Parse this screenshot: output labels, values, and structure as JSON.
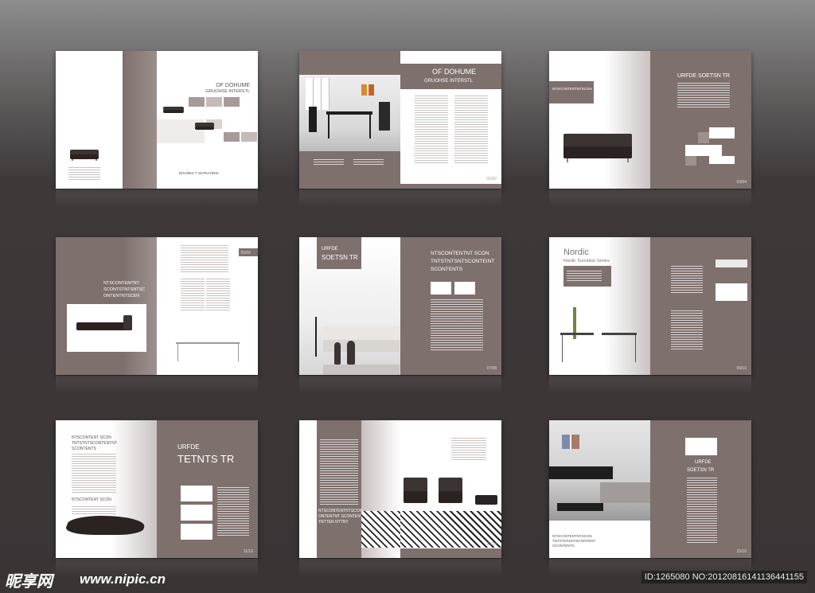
{
  "spread1": {
    "title_line1": "OF DOHUME",
    "title_line2": "GRUOHSE INTERSTL",
    "footer_text": "BOUNES T WARUVBGK"
  },
  "spread2": {
    "title_line1": "OF DOHUME",
    "title_line2": "GRUOHSE INTERSTL",
    "page": "01/02"
  },
  "spread3": {
    "heading": "URFDE   SOETSN   TR",
    "banner": "NTSCONTENTNTSCON",
    "page": "03/04"
  },
  "spread4": {
    "heading_l1": "NTSCONTENTNT",
    "heading_l2": "SCONTSTNTSNTSC",
    "heading_l3": "ONTENTNTSCEN",
    "page": "05/06"
  },
  "spread5": {
    "tab_l1": "URFDE",
    "tab_l2": "SOETSN   TR",
    "heading_l1": "NTSCONTENTNT   SCON",
    "heading_l2": "TNTSTNTSNTSCONTEINT",
    "heading_l3": "SCONTENTS",
    "page": "07/08"
  },
  "spread6": {
    "brand": "Nordic",
    "subtitle": "Nordic Sunshine Series",
    "page": "09/10"
  },
  "spread7": {
    "heading_l1": "URFDE",
    "heading_l2": "TETNTS   TR",
    "left_head_l1": "NTSCONTENT   SCON",
    "left_head_l2": "TNTSTNTSCONTENTNT",
    "left_head_l3": "SCONTENTS",
    "mid_head": "NTSCONTENT   SCON",
    "page": "11/12"
  },
  "spread8": {
    "heading_l1": "NTSCONTENTNTSCON",
    "heading_l2": "ONTENTNT SCONTENTNTS",
    "heading_l3": "TNTTER NTTNT",
    "page": "13/14"
  },
  "spread9": {
    "heading_l1": "URFDE",
    "heading_l2": "SOETSN   TR",
    "caption_l1": "NTSCONTENTNTSCON",
    "caption_l2": "TNTSTNTSNTSCONTENT",
    "caption_l3": "SCONTENTS",
    "page": "15/16"
  },
  "watermark": {
    "logo": "昵享网",
    "site": "www.nipic.cn",
    "id": "ID:1265080 NO:20120816141136441155"
  },
  "colors": {
    "taupe": "#7e706d",
    "background_top": "#8d8d8d",
    "background_bottom": "#3a3435"
  }
}
